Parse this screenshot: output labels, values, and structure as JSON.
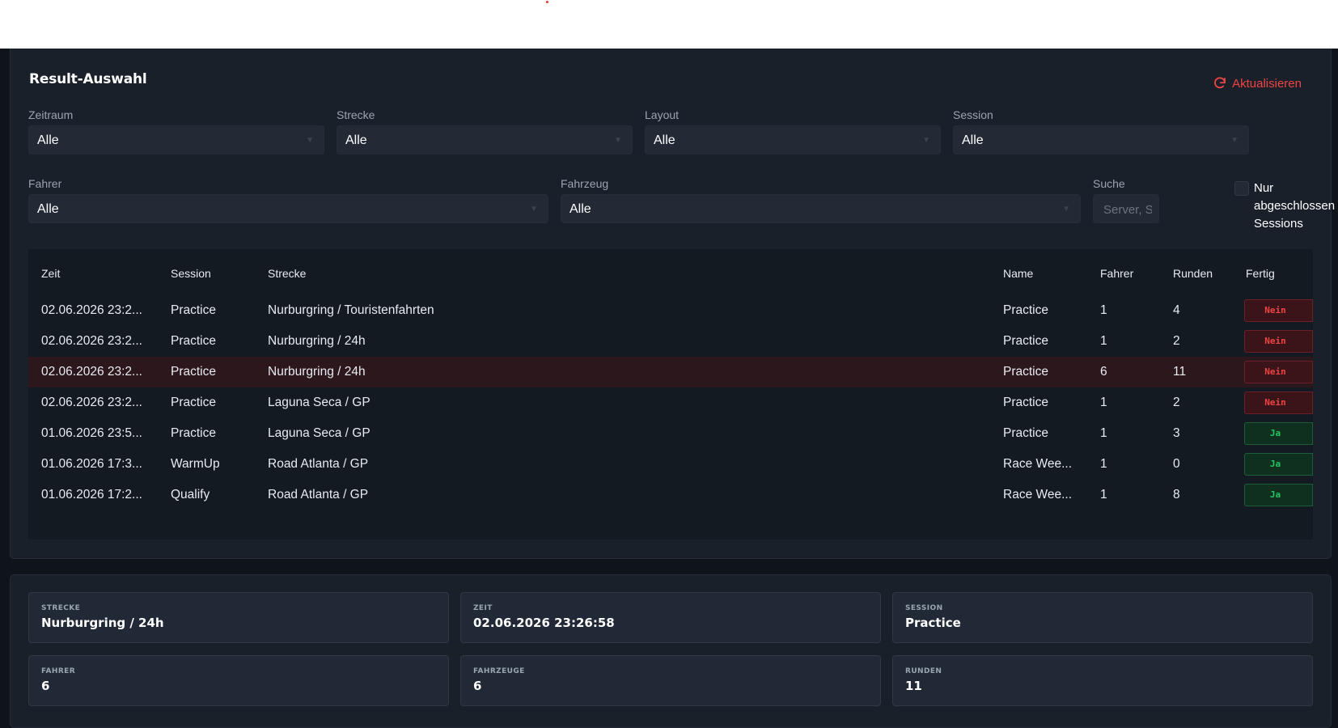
{
  "selection": {
    "title": "Result-Auswahl",
    "refresh_label": "Aktualisieren",
    "filters": {
      "zeitraum": {
        "label": "Zeitraum",
        "value": "Alle"
      },
      "strecke": {
        "label": "Strecke",
        "value": "Alle"
      },
      "layout": {
        "label": "Layout",
        "value": "Alle"
      },
      "session": {
        "label": "Session",
        "value": "Alle"
      },
      "fahrer": {
        "label": "Fahrer",
        "value": "Alle"
      },
      "fahrzeug": {
        "label": "Fahrzeug",
        "value": "Alle"
      },
      "suche": {
        "label": "Suche",
        "placeholder": "Server, Si"
      },
      "only_finished": {
        "label_lines": [
          "Nur",
          "abgeschlossen",
          "Sessions"
        ],
        "checked": false
      }
    },
    "table": {
      "headers": {
        "zeit": "Zeit",
        "session": "Session",
        "strecke": "Strecke",
        "name": "Name",
        "fahrer": "Fahrer",
        "runden": "Runden",
        "fertig": "Fertig"
      },
      "rows": [
        {
          "zeit": "02.06.2026 23:2...",
          "session": "Practice",
          "strecke": "Nurburgring / Touristenfahrten",
          "name": "Practice",
          "fahrer": "1",
          "runden": "4",
          "fertig": "Nein",
          "done": false,
          "selected": false
        },
        {
          "zeit": "02.06.2026 23:2...",
          "session": "Practice",
          "strecke": "Nurburgring / 24h",
          "name": "Practice",
          "fahrer": "1",
          "runden": "2",
          "fertig": "Nein",
          "done": false,
          "selected": false
        },
        {
          "zeit": "02.06.2026 23:2...",
          "session": "Practice",
          "strecke": "Nurburgring / 24h",
          "name": "Practice",
          "fahrer": "6",
          "runden": "11",
          "fertig": "Nein",
          "done": false,
          "selected": true
        },
        {
          "zeit": "02.06.2026 23:2...",
          "session": "Practice",
          "strecke": "Laguna Seca / GP",
          "name": "Practice",
          "fahrer": "1",
          "runden": "2",
          "fertig": "Nein",
          "done": false,
          "selected": false
        },
        {
          "zeit": "01.06.2026 23:5...",
          "session": "Practice",
          "strecke": "Laguna Seca / GP",
          "name": "Practice",
          "fahrer": "1",
          "runden": "3",
          "fertig": "Ja",
          "done": true,
          "selected": false
        },
        {
          "zeit": "01.06.2026 17:3...",
          "session": "WarmUp",
          "strecke": "Road Atlanta / GP",
          "name": "Race Wee...",
          "fahrer": "1",
          "runden": "0",
          "fertig": "Ja",
          "done": true,
          "selected": false
        },
        {
          "zeit": "01.06.2026 17:2...",
          "session": "Qualify",
          "strecke": "Road Atlanta / GP",
          "name": "Race Wee...",
          "fahrer": "1",
          "runden": "8",
          "fertig": "Ja",
          "done": true,
          "selected": false
        }
      ]
    }
  },
  "details": {
    "strecke": {
      "label": "STRECKE",
      "value": "Nurburgring / 24h"
    },
    "zeit": {
      "label": "ZEIT",
      "value": "02.06.2026 23:26:58"
    },
    "session": {
      "label": "SESSION",
      "value": "Practice"
    },
    "fahrer": {
      "label": "FAHRER",
      "value": "6"
    },
    "fahrzeuge": {
      "label": "FAHRZEUGE",
      "value": "6"
    },
    "runden": {
      "label": "RUNDEN",
      "value": "11"
    }
  },
  "colors": {
    "accent": "#ef4444",
    "success": "#22c55e",
    "background": "#0f141b",
    "panel": "#1a202a"
  }
}
